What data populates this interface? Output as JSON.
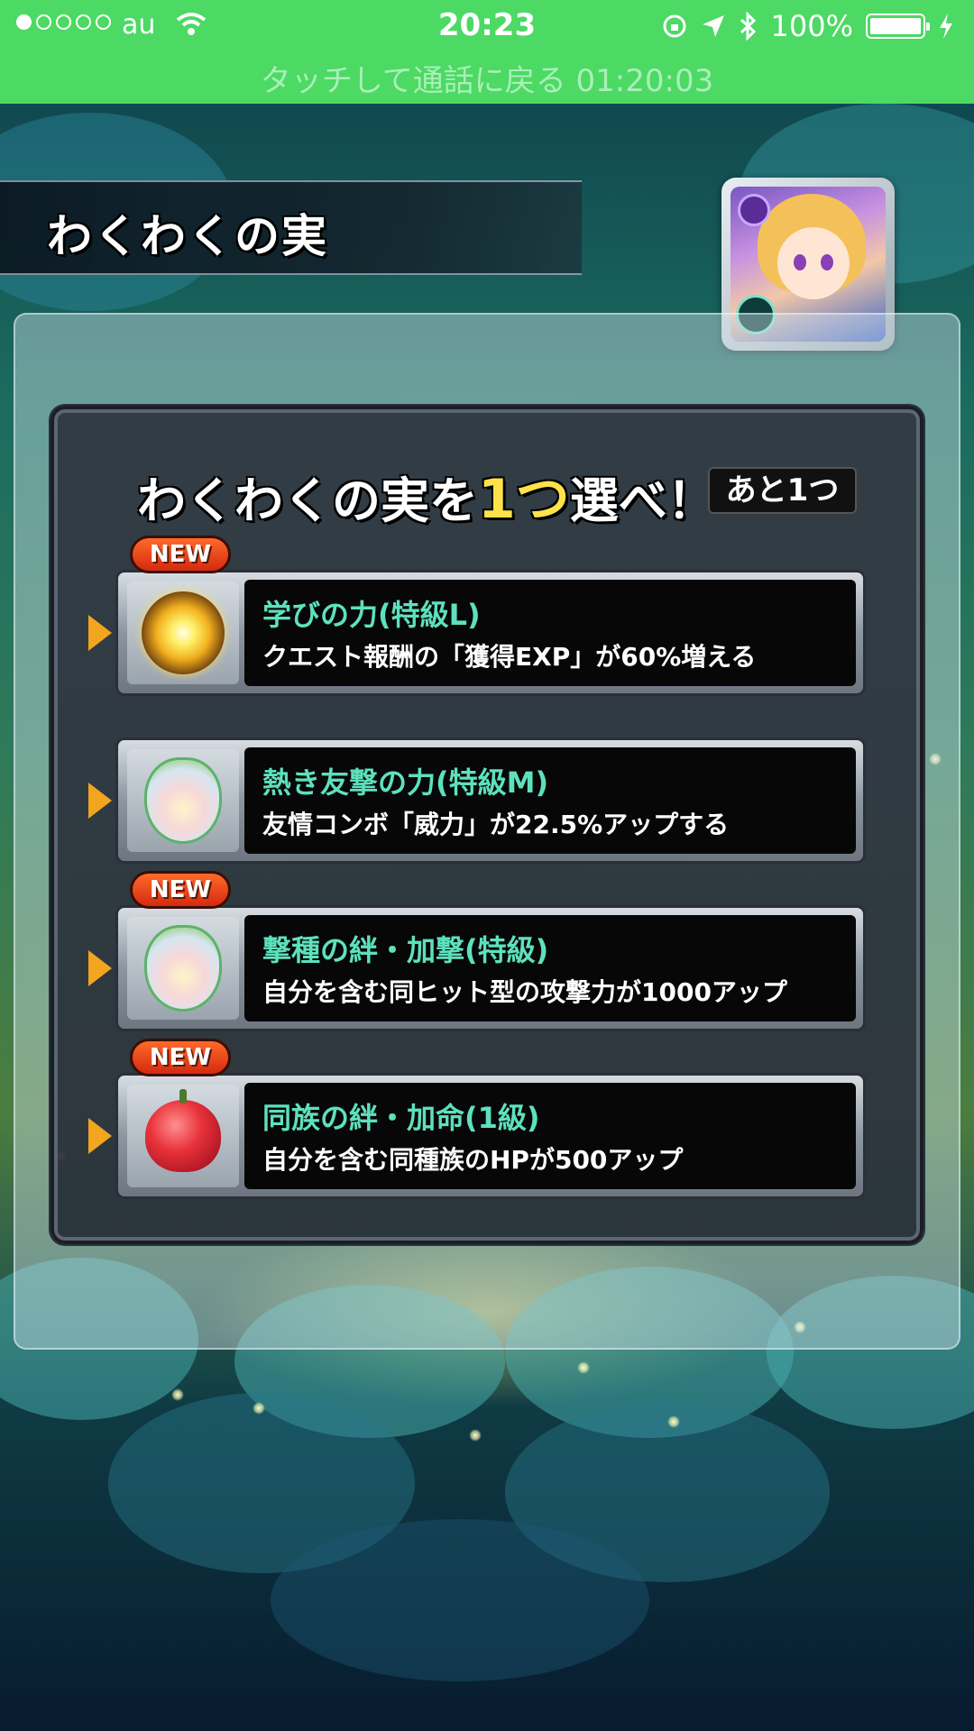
{
  "status_bar": {
    "carrier": "au",
    "time": "20:23",
    "battery": "100%",
    "call_banner": "タッチして通話に戻る 01:20:03",
    "signal_bars_filled": 1,
    "signal_bars_total": 5
  },
  "screen": {
    "title": "わくわくの実"
  },
  "selection": {
    "heading_prefix": "わくわくの実を",
    "heading_accent": "1つ",
    "heading_suffix": "選べ！",
    "remaining": "あと1つ"
  },
  "options": [
    {
      "new_badge": "NEW",
      "name": "学びの力(特級L)",
      "description": "クエスト報酬の「獲得EXP」が60%増える",
      "icon": "sun-fruit-icon"
    },
    {
      "new_badge": "",
      "name": "熱き友撃の力(特級M)",
      "description": "友情コンボ「威力」が22.5%アップする",
      "icon": "lotus-fruit-icon"
    },
    {
      "new_badge": "NEW",
      "name": "撃種の絆・加撃(特級)",
      "description": "自分を含む同ヒット型の攻撃力が1000アップ",
      "icon": "lotus-fruit-icon"
    },
    {
      "new_badge": "NEW",
      "name": "同族の絆・加命(1級)",
      "description": "自分を含む同種族のHPが500アップ",
      "icon": "apple-fruit-icon"
    }
  ],
  "colors": {
    "status_green": "#4cd964",
    "option_name": "#5de1bd",
    "accent_yellow": "#ffe24a",
    "arrow_orange": "#f2a51f",
    "new_badge": "#e0401a"
  }
}
